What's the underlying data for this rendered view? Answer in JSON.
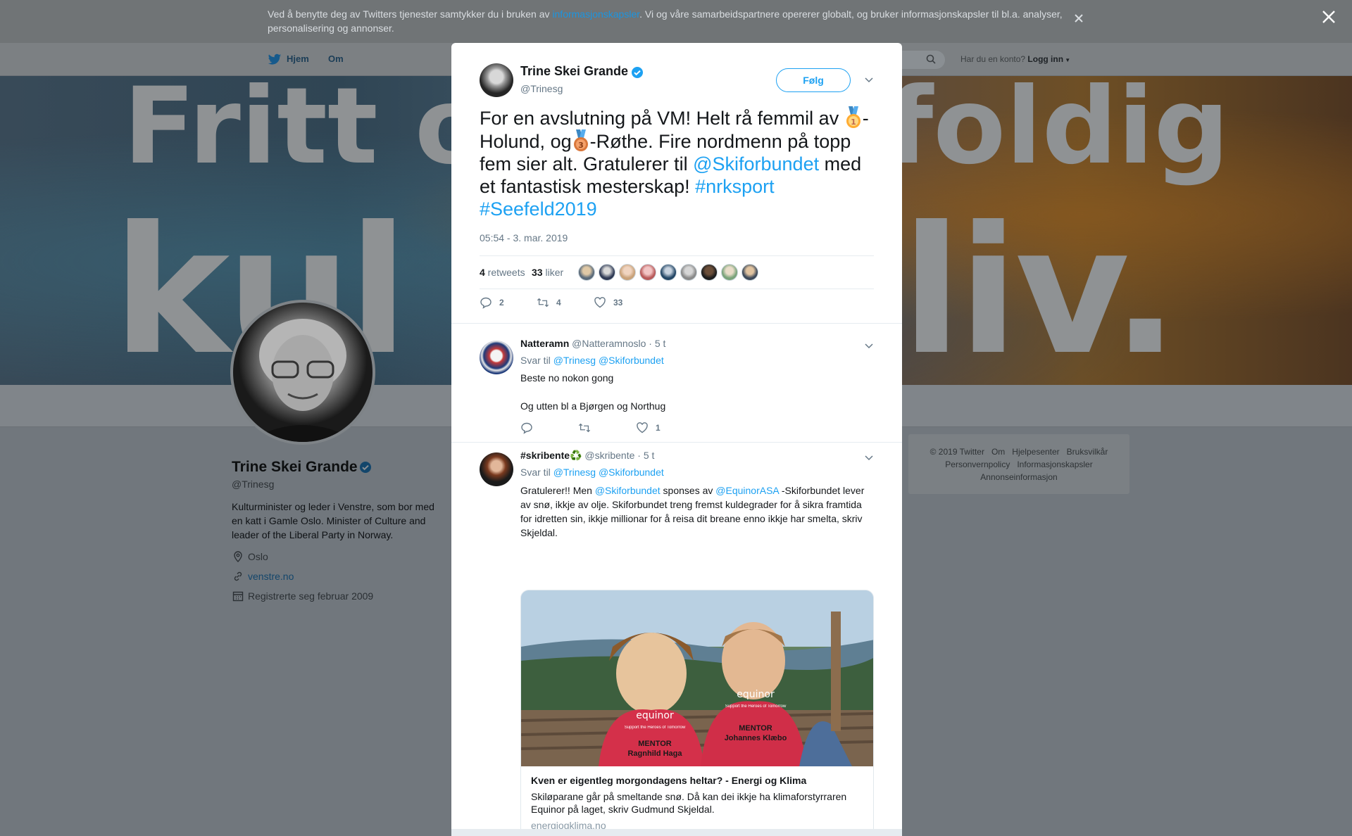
{
  "cookie": {
    "text_before": "Ved å benytte deg av Twitters tjenester samtykker du i bruken av ",
    "link": "informasjonskapsler",
    "text_after": ". Vi og våre samarbeidspartnere opererer globalt, og bruker informasjonskapsler til bl.a. analyser, personalisering og annonser."
  },
  "nav": {
    "home": "Hjem",
    "about": "Om",
    "have_account": "Har du en konto?",
    "login": "Logg inn"
  },
  "banner": {
    "line1_left": "Fritt o",
    "line1_right": "foldig",
    "line2_left": "kul",
    "line2_right": "liv."
  },
  "profile": {
    "name": "Trine Skei Grande",
    "handle": "@Trinesg",
    "bio": "Kulturminister og leder i Venstre, som bor med en katt i Gamle Oslo. Minister of Culture and leader of the Liberal Party in Norway.",
    "location": "Oslo",
    "website": "venstre.no",
    "joined": "Registrerte seg februar 2009"
  },
  "footer": {
    "copyright": "© 2019 Twitter",
    "about": "Om",
    "help": "Hjelpesenter",
    "terms": "Bruksvilkår",
    "privacy": "Personvernpolicy",
    "cookies": "Informasjonskapsler",
    "ads": "Annonseinformasjon"
  },
  "tweet": {
    "name": "Trine Skei Grande",
    "handle": "@Trinesg",
    "follow": "Følg",
    "text_1": "For en avslutning på VM! Helt rå femmil av ",
    "text_2": "-Holund, og",
    "text_3": "-Røthe. Fire nordmenn på topp fem sier alt. Gratulerer til ",
    "mention": "@Skiforbundet",
    "text_4": " med et fantastisk mesterskap! ",
    "hashtag1": "#nrksport",
    "hashtag2": "#Seefeld2019",
    "time": "05:54 - 3. mar. 2019",
    "retweets_count": "4",
    "retweets_label": " retweets",
    "likes_count": "33",
    "likes_label": " liker",
    "replies": "2",
    "rt_action": "4",
    "like_action": "33"
  },
  "replies": [
    {
      "name": "Natteramn",
      "handle": "@Natteramnoslo",
      "time": "· 5 t",
      "reply_to": "Svar til",
      "to1": "@Trinesg",
      "to2": "@Skiforbundet",
      "line1": "Beste no nokon gong",
      "line2": "Og utten bl a Bjørgen og Northug",
      "likes": "1"
    },
    {
      "name": "#skribente♻️",
      "handle": "@skribente",
      "time": "· 5 t",
      "reply_to": "Svar til",
      "to1": "@Trinesg",
      "to2": "@Skiforbundet",
      "b1": "Gratulerer!! Men ",
      "m1": "@Skiforbundet",
      "b2": " sponses av ",
      "m2": "@EquinorASA",
      "b3": " -Skiforbundet lever av snø, ikkje av olje. Skiforbundet treng fremst kuldegrader for å sikra framtida for idretten sin, ikkje millionar for å reisa dit breane enno ikkje har smelta, skriv Skjeldal.",
      "card_title": "Kven er eigentleg morgondagens heltar? - Energi og Klima",
      "card_desc": "Skiløparane går på smeltande snø. Då kan dei ikkje ha klimaforstyrraren Equinor på laget, skriv Gudmund Skjeldal.",
      "card_domain": "energiogklima.no",
      "bib_brand": "equinor",
      "bib_tagline": "Support the Heroes of Tomorrow",
      "bib1_l1": "MENTOR",
      "bib1_l2": "Ragnhild Haga",
      "bib2_l1": "MENTOR",
      "bib2_l2": "Johannes Klæbo"
    }
  ],
  "colors": {
    "accent": "#1da1f2",
    "text": "#14171a",
    "muted": "#657786",
    "border": "#e6ecf0"
  }
}
